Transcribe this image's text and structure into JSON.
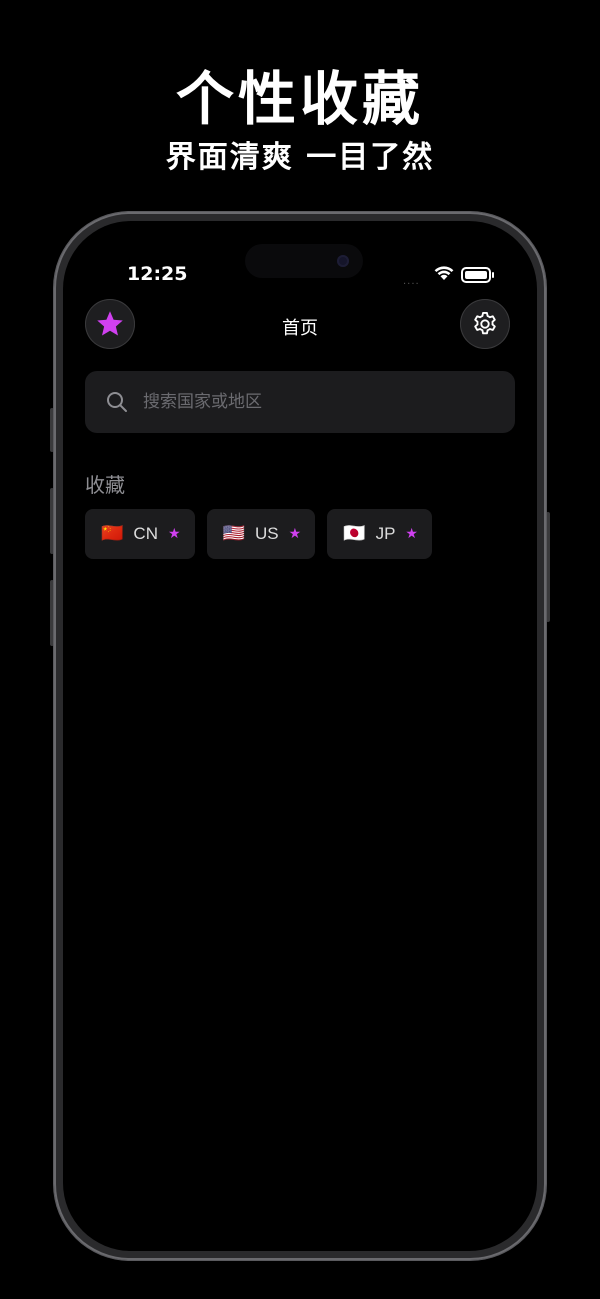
{
  "promo": {
    "title": "个性收藏",
    "subtitle": "界面清爽 一目了然"
  },
  "status_bar": {
    "time": "12:25",
    "signal": "....",
    "icons": [
      "wifi-icon",
      "battery-icon"
    ]
  },
  "nav": {
    "title": "首页",
    "left_icon": "star-icon",
    "right_icon": "gear-icon"
  },
  "search": {
    "placeholder": "搜索国家或地区",
    "value": ""
  },
  "favorites": {
    "label": "收藏",
    "items": [
      {
        "flag": "🇨🇳",
        "code": "CN",
        "star": "★"
      },
      {
        "flag": "🇺🇸",
        "code": "US",
        "star": "★"
      },
      {
        "flag": "🇯🇵",
        "code": "JP",
        "star": "★"
      }
    ]
  },
  "colors": {
    "accent": "#d040f0",
    "background": "#000000",
    "card": "#1c1c1e",
    "muted_text": "#8e8e93"
  }
}
